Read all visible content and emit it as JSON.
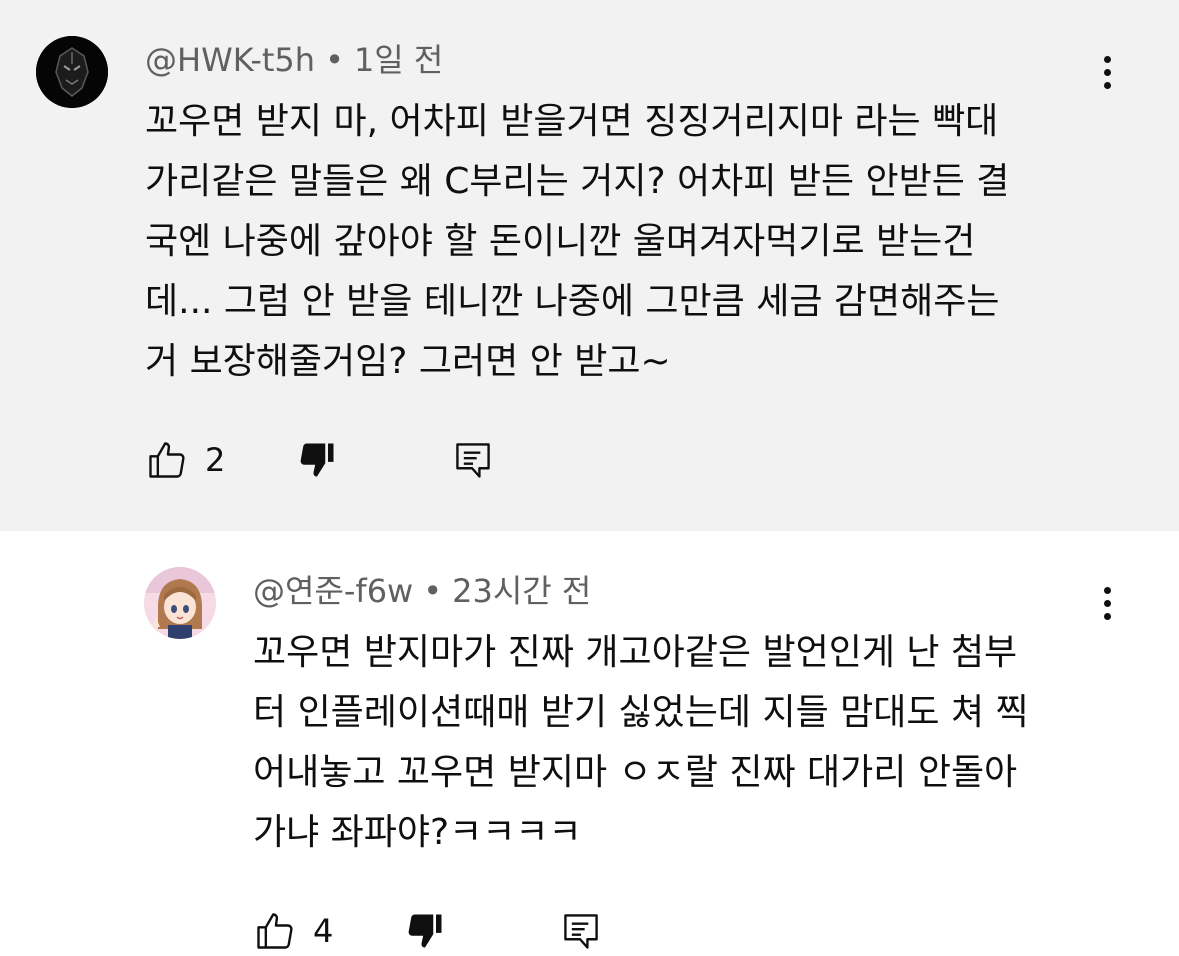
{
  "comments": [
    {
      "author": "@HWK-t5h",
      "separator": "•",
      "time": "1일 전",
      "text": "꼬우면 받지 마, 어차피 받을거면 징징거리지마 라는 빡대\n가리같은 말들은 왜 C부리는 거지? 어차피 받든 안받든 결\n국엔 나중에 갚아야 할 돈이니깐 울며겨자먹기로 받는건\n데... 그럼 안 받을 테니깐 나중에 그만큼 세금 감면해주는\n거 보장해줄거임? 그러면 안 받고~",
      "likes": "2",
      "icons": {
        "like": "thumbs-up-outline-icon",
        "dislike": "thumbs-down-filled-icon",
        "reply": "reply-comment-icon",
        "more": "more-vert-icon"
      }
    },
    {
      "author": "@연준-f6w",
      "separator": "•",
      "time": "23시간 전",
      "text": "꼬우면 받지마가 진짜 개고아같은 발언인게 난 첨부\n터 인플레이션때매 받기 싫었는데 지들 맘대도 쳐 찍\n어내놓고 꼬우면 받지마 ㅇㅈ랄 진짜 대가리 안돌아\n가냐 좌파야?ㅋㅋㅋㅋ",
      "likes": "4",
      "icons": {
        "like": "thumbs-up-outline-icon",
        "dislike": "thumbs-down-filled-icon",
        "reply": "reply-comment-icon",
        "more": "more-vert-icon"
      }
    }
  ],
  "colors": {
    "highlight_background": "#f2f2f2",
    "meta_text": "#606060",
    "body_text": "#0f0f0f"
  }
}
